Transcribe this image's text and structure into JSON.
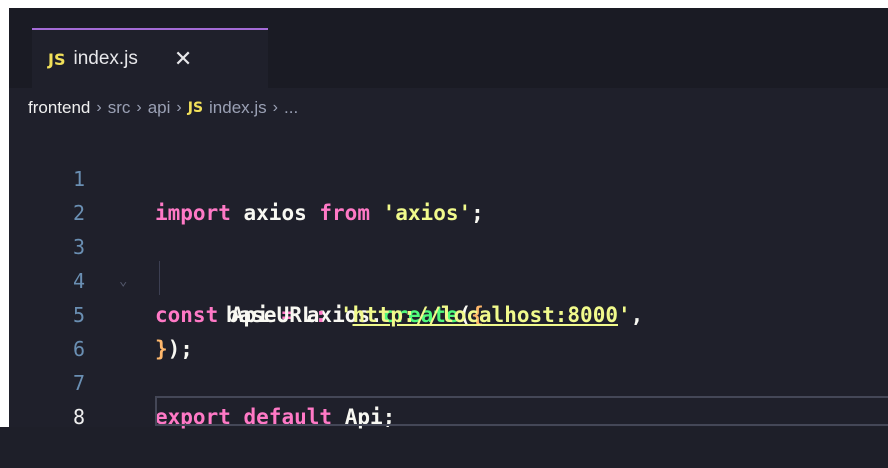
{
  "tab": {
    "badge": "JS",
    "filename": "index.js",
    "close": "✕"
  },
  "breadcrumb": {
    "items": [
      "frontend",
      "src",
      "api",
      "index.js",
      "..."
    ],
    "separator": "›",
    "badge": "JS"
  },
  "editor": {
    "active_line": 8,
    "lines": [
      {
        "num": "1"
      },
      {
        "num": "2"
      },
      {
        "num": "3"
      },
      {
        "num": "4"
      },
      {
        "num": "5"
      },
      {
        "num": "6"
      },
      {
        "num": "7"
      },
      {
        "num": "8"
      }
    ],
    "tokens": {
      "l1_import": "import",
      "l1_axios": "axios",
      "l1_from": "from",
      "l1_str": "'axios'",
      "l1_semi": ";",
      "l3_const": "const",
      "l3_api": "Api",
      "l3_eq": "=",
      "l3_axios": "axios",
      "l3_dot": ".",
      "l3_create": "create",
      "l3_paren": "(",
      "l3_brace": "{",
      "l4_key": "baseURL",
      "l4_colon": ":",
      "l4_q1": "'",
      "l4_url": "http://localhost:8000",
      "l4_q2": "'",
      "l4_comma": ",",
      "l5_brace": "}",
      "l5_paren": ");",
      "l7_export": "export",
      "l7_default": "default",
      "l7_api": "Api",
      "l7_semi": ";"
    }
  },
  "colors": {
    "background": "#1f202b",
    "keyword": "#ff79c6",
    "function": "#50fa7b",
    "string": "#f1fa8c",
    "line_number": "#6a8fb3",
    "js_badge": "#f1e05a"
  }
}
